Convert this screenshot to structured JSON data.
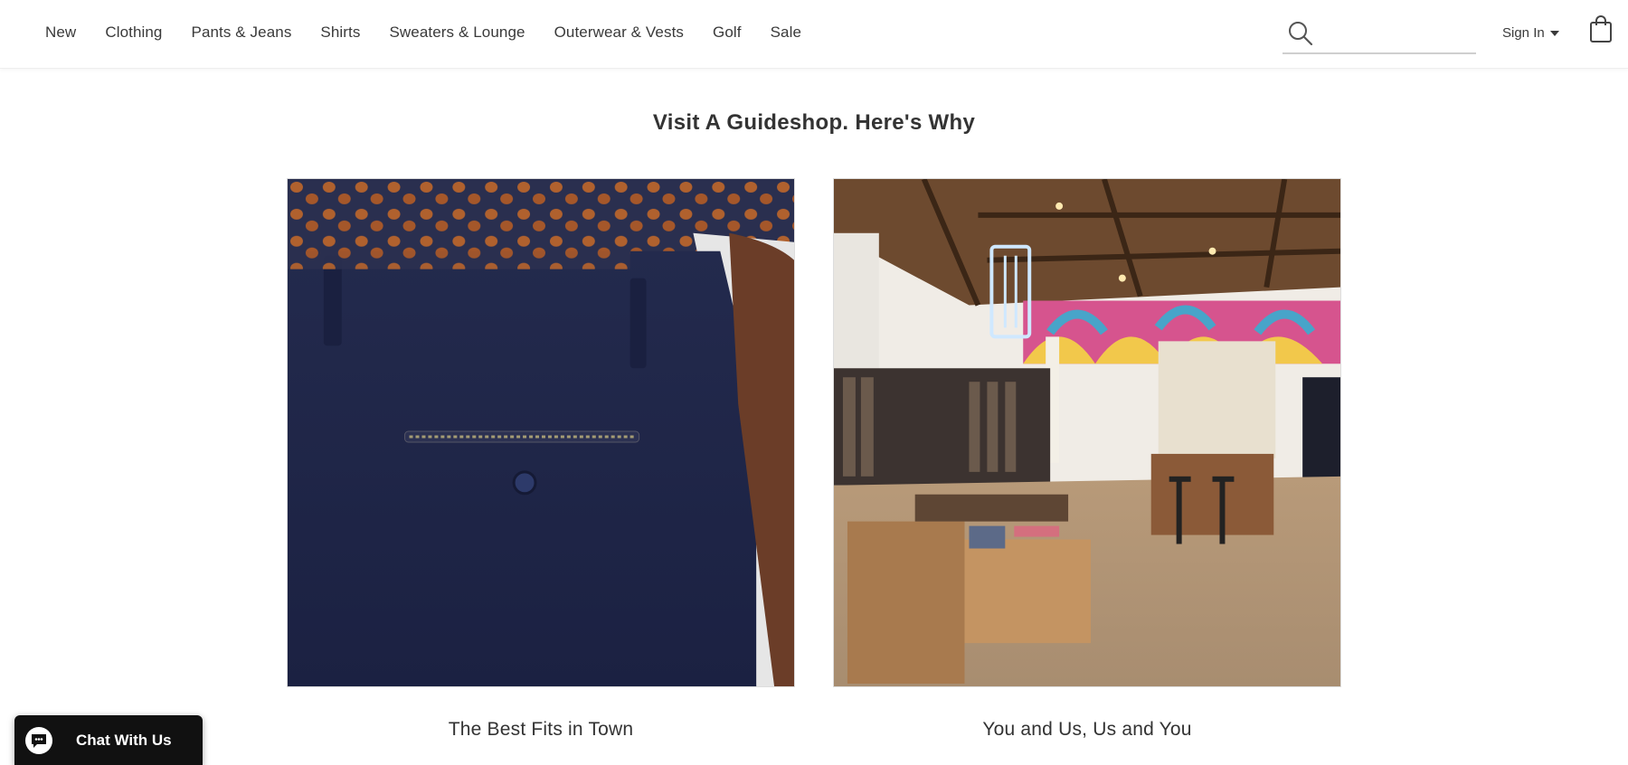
{
  "nav": {
    "items": [
      "New",
      "Clothing",
      "Pants & Jeans",
      "Shirts",
      "Sweaters & Lounge",
      "Outerwear & Vests",
      "Golf",
      "Sale"
    ]
  },
  "search": {
    "placeholder": "",
    "value": ""
  },
  "account": {
    "signin_label": "Sign In"
  },
  "main": {
    "heading": "Visit A Guideshop. Here's Why",
    "cards": [
      {
        "caption": "The Best Fits in Town",
        "image": "navy-chino-back-pocket-photo"
      },
      {
        "caption": "You and Us, Us and You",
        "image": "guideshop-store-interior-photo"
      }
    ]
  },
  "chat": {
    "label": "Chat With Us"
  },
  "icons": {
    "search": "search-icon",
    "bag": "shopping-bag-icon",
    "chat": "chat-bubble-icon"
  }
}
